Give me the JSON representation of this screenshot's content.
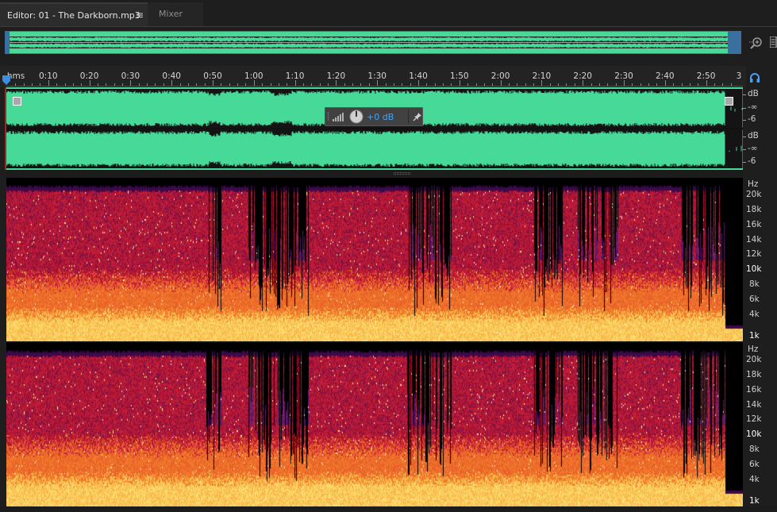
{
  "tabs": {
    "editor_label": "Editor: 01 - The Darkborn.mp3",
    "menu_icon": "≡",
    "mixer_label": "Mixer"
  },
  "ruler": {
    "unit_label": "hms",
    "labels": [
      "0:10",
      "0:20",
      "0:30",
      "0:40",
      "0:50",
      "1:00",
      "1:10",
      "1:20",
      "1:30",
      "1:40",
      "1:50",
      "2:00",
      "2:10",
      "2:20",
      "2:30",
      "2:40",
      "2:50"
    ],
    "end_label": "3"
  },
  "hud": {
    "value": "+0 dB"
  },
  "db_scale": {
    "channel_1": [
      "dB",
      "-∞",
      "-6"
    ],
    "channel_2": [
      "dB",
      "-∞",
      "-6"
    ]
  },
  "hz_scale": {
    "channel_1": [
      "Hz",
      "20k",
      "18k",
      "16k",
      "14k",
      "12k",
      "10k",
      "8k",
      "6k",
      "4k",
      "1k"
    ],
    "channel_2": [
      "Hz",
      "20k",
      "18k",
      "16k",
      "14k",
      "12k",
      "10k",
      "8k",
      "6k",
      "4k",
      "1k"
    ]
  },
  "colors": {
    "waveform": "#46d998",
    "waveform_ink": "#141414",
    "selection_border": "#2e7ec6",
    "hud_value": "#3fa3ff"
  },
  "icons": {
    "zoom": "zoom-in-icon",
    "panel_menu": "panel-menu-icon",
    "headphones": "headphones-icon",
    "pin": "pin-icon",
    "tab_menu": "tab-menu-icon"
  }
}
